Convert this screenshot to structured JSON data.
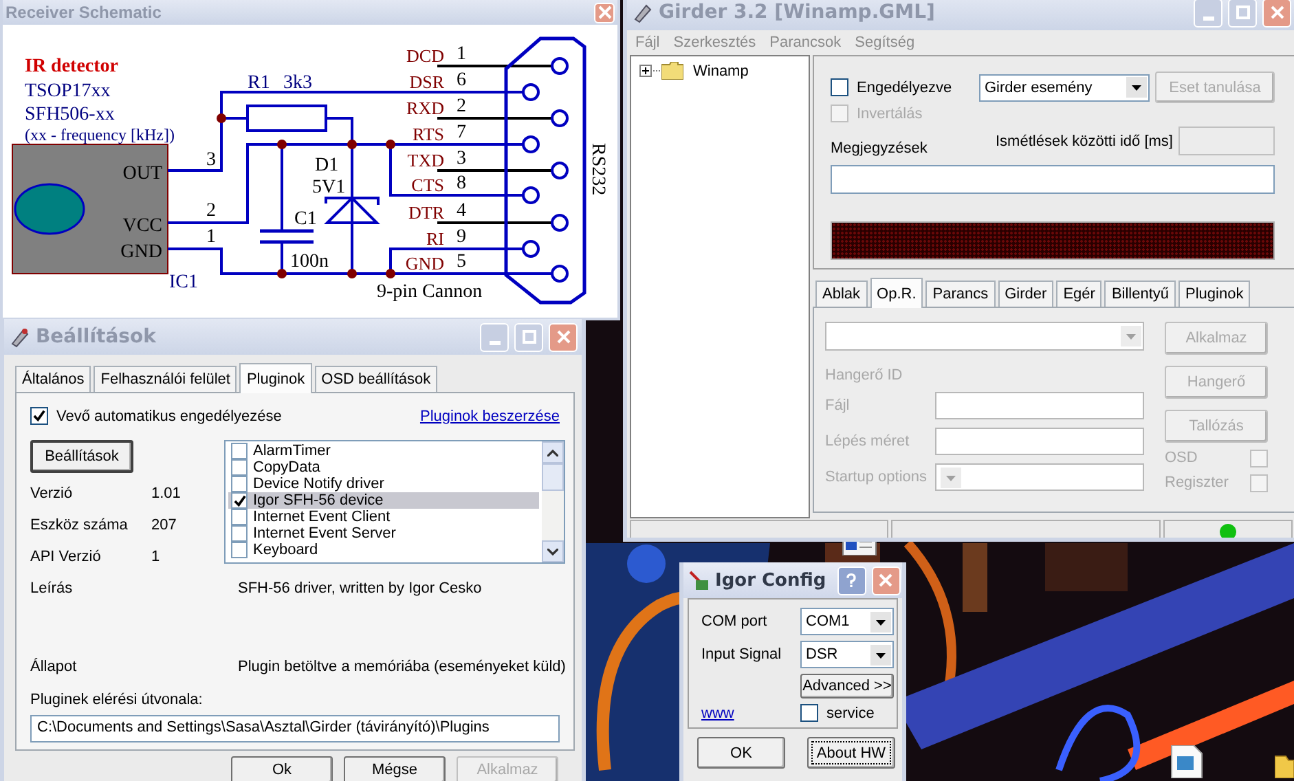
{
  "schematic_window": {
    "title": "Receiver Schematic",
    "schematic": {
      "heading": "IR detector",
      "part_numbers": [
        "TSOP17xx",
        "SFH506-xx",
        "(xx - frequency [kHz])"
      ],
      "ic_pins": [
        "OUT",
        "VCC",
        "GND"
      ],
      "ic_name": "IC1",
      "wire_numbers": [
        "3",
        "2",
        "1"
      ],
      "resistor": [
        "R1",
        "3k3"
      ],
      "diode": [
        "D1",
        "5V1"
      ],
      "capacitor": [
        "C1",
        "100n"
      ],
      "port_pins": [
        {
          "signal": "DCD",
          "number": "1"
        },
        {
          "signal": "DSR",
          "number": "6"
        },
        {
          "signal": "RXD",
          "number": "2"
        },
        {
          "signal": "RTS",
          "number": "7"
        },
        {
          "signal": "TXD",
          "number": "3"
        },
        {
          "signal": "CTS",
          "number": "8"
        },
        {
          "signal": "DTR",
          "number": "4"
        },
        {
          "signal": "RI",
          "number": "9"
        },
        {
          "signal": "GND",
          "number": "5"
        }
      ],
      "connector": "9-pin Cannon",
      "port": "RS232"
    }
  },
  "settings_window": {
    "title": "Beállítások",
    "tabs": [
      {
        "label": "Általános",
        "selected": false
      },
      {
        "label": "Felhasználói felület",
        "selected": false
      },
      {
        "label": "Pluginok",
        "selected": true
      },
      {
        "label": "OSD beállítások",
        "selected": false
      }
    ],
    "auto_enable": {
      "label": "Vevő automatikus engedélyezése",
      "checked": true
    },
    "get_plugins_link": "Pluginok beszerzése",
    "plugin_settings_button": "Beállítások",
    "info": [
      {
        "label": "Verzió",
        "value": "1.01"
      },
      {
        "label": "Eszköz száma",
        "value": "207"
      },
      {
        "label": "API Verzió",
        "value": "1"
      }
    ],
    "plugins": [
      {
        "name": "AlarmTimer",
        "checked": false,
        "selected": false
      },
      {
        "name": "CopyData",
        "checked": false,
        "selected": false
      },
      {
        "name": "Device Notify driver",
        "checked": false,
        "selected": false
      },
      {
        "name": "Igor SFH-56 device",
        "checked": true,
        "selected": true
      },
      {
        "name": "Internet Event Client",
        "checked": false,
        "selected": false
      },
      {
        "name": "Internet Event Server",
        "checked": false,
        "selected": false
      },
      {
        "name": "Keyboard",
        "checked": false,
        "selected": false
      }
    ],
    "description": {
      "label": "Leírás",
      "value": "SFH-56 driver, written by Igor Cesko"
    },
    "status": {
      "label": "Állapot",
      "value": "Plugin betöltve a memóriába (eseményeket küld)"
    },
    "plugin_path": {
      "label": "Pluginek elérési útvonala:",
      "value": "C:\\Documents and Settings\\Sasa\\Asztal\\Girder (távirányító)\\Plugins"
    },
    "buttons": [
      {
        "label": "Ok",
        "disabled": false
      },
      {
        "label": "Mégse",
        "disabled": false
      },
      {
        "label": "Alkalmaz",
        "disabled": true
      }
    ]
  },
  "girder_window": {
    "title": "Girder 3.2 [Winamp.GML]",
    "menu": [
      "Fájl",
      "Szerkesztés",
      "Parancsok",
      "Segítség"
    ],
    "tree": [
      {
        "label": "Winamp",
        "expanded": false
      }
    ],
    "enabled": {
      "label": "Engedélyezve",
      "checked": false,
      "disabled": false
    },
    "inverted": {
      "label": "Invertálás",
      "checked": false,
      "disabled": true
    },
    "event_type": "Girder esemény",
    "learn_button": {
      "label": "Eset tanulása",
      "disabled": true
    },
    "repeat_delay": {
      "label": "Ismétlések közötti idő [ms]",
      "disabled": true
    },
    "notes_label": "Megjegyzések",
    "tabs": [
      {
        "label": "Ablak",
        "selected": false
      },
      {
        "label": "Op.R.",
        "selected": true
      },
      {
        "label": "Parancs",
        "selected": false
      },
      {
        "label": "Girder",
        "selected": false
      },
      {
        "label": "Egér",
        "selected": false
      },
      {
        "label": "Billentyű",
        "selected": false
      },
      {
        "label": "Pluginok",
        "selected": false
      }
    ],
    "op_panel": {
      "disabled": true,
      "apply_button": "Alkalmaz",
      "volume_id_label": "Hangerő ID",
      "volume_button": "Hangerő",
      "file_label": "Fájl",
      "browse_button": "Tallózás",
      "step_label": "Lépés méret",
      "startup_label": "Startup options",
      "osd": {
        "label": "OSD",
        "checked": false
      },
      "register": {
        "label": "Regiszter",
        "checked": false
      }
    },
    "status_led": {
      "on": true
    }
  },
  "igor_config_window": {
    "title": "Igor Config",
    "fields": [
      {
        "label": "COM port",
        "value": "COM1"
      },
      {
        "label": "Input Signal",
        "value": "DSR"
      }
    ],
    "advanced_button": "Advanced >>",
    "www_link": "www",
    "service": {
      "label": "service",
      "checked": false
    },
    "buttons": [
      {
        "label": "OK",
        "focused": false
      },
      {
        "label": "About HW",
        "focused": true
      }
    ]
  }
}
